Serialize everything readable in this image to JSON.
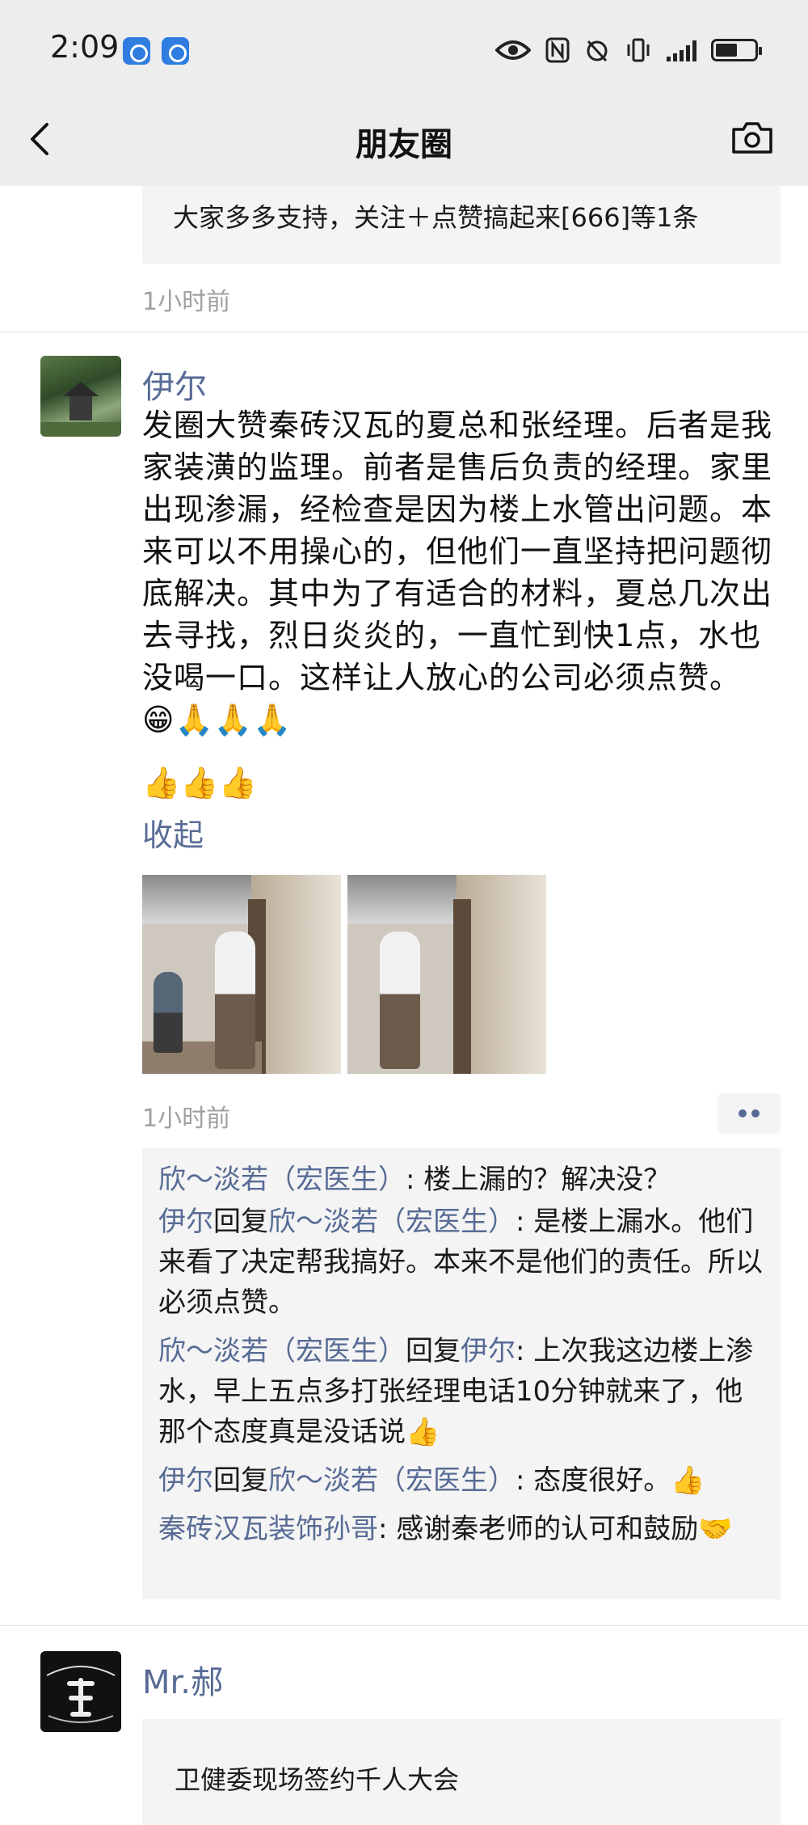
{
  "status_bar": {
    "time": "2:09"
  },
  "nav": {
    "title": "朋友圈"
  },
  "prev_post": {
    "like_text": "大家多多支持，关注＋点赞搞起来[666]等1条",
    "time": "1小时前"
  },
  "post": {
    "author": "伊尔",
    "text": "发圈大赞秦砖汉瓦的夏总和张经理。后者是我家装潢的监理。前者是售后负责的经理。家里出现渗漏，经检查是因为楼上水管出问题。本来可以不用操心的，但他们一直坚持把问题彻底解决。其中为了有适合的材料，夏总几次出去寻找，烈日炎炎的，一直忙到快1点，水也没喝一口。这样让人放心的公司必须点赞。😁🙏🙏🙏",
    "emoji_line": "👍👍👍",
    "collapse_label": "收起",
    "time": "1小时前",
    "comments": [
      {
        "name": "欣～淡若（宏医生）",
        "reply_word": "",
        "reply_to": "",
        "text": ": 楼上漏的？解决没？"
      },
      {
        "name": "伊尔",
        "reply_word": "回复",
        "reply_to": "欣～淡若（宏医生）",
        "text": ": 是楼上漏水。他们来看了决定帮我搞好。本来不是他们的责任。所以必须点赞。"
      },
      {
        "name": "欣～淡若（宏医生）",
        "reply_word": "回复",
        "reply_to": "伊尔",
        "text": ": 上次我这边楼上渗水，早上五点多打张经理电话10分钟就来了，他那个态度真是没话说👍"
      },
      {
        "name": "伊尔",
        "reply_word": "回复",
        "reply_to": "欣～淡若（宏医生）",
        "text": ": 态度很好。👍"
      },
      {
        "name": "秦砖汉瓦装饰孙哥",
        "reply_word": "",
        "reply_to": "",
        "text": ": 感谢秦老师的认可和鼓励🤝"
      }
    ]
  },
  "next_post": {
    "author": "Mr.郝",
    "share_text": "卫健委现场签约千人大会"
  },
  "colors": {
    "link": "#576b95",
    "header_bg": "#ededed",
    "box_bg": "#f4f4f4"
  }
}
